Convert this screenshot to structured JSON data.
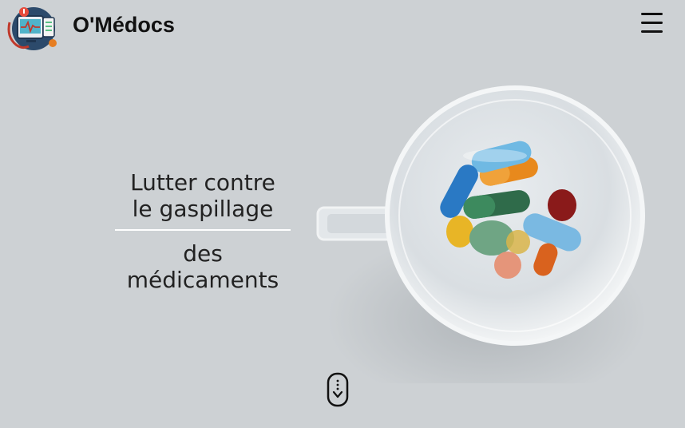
{
  "header": {
    "brand": "O'Médocs",
    "logo_icon": "medical-monitor-logo",
    "menu_icon": "hamburger-icon"
  },
  "hero": {
    "line1a": "Lutter contre",
    "line1b": "le gaspillage",
    "line2a": "des",
    "line2b": "médicaments",
    "image": "glass-cup-of-pills"
  },
  "scroll": {
    "icon": "mouse-scroll-down-icon"
  },
  "colors": {
    "background": "#cdd1d4",
    "divider": "#ffffff",
    "text": "#222222"
  }
}
